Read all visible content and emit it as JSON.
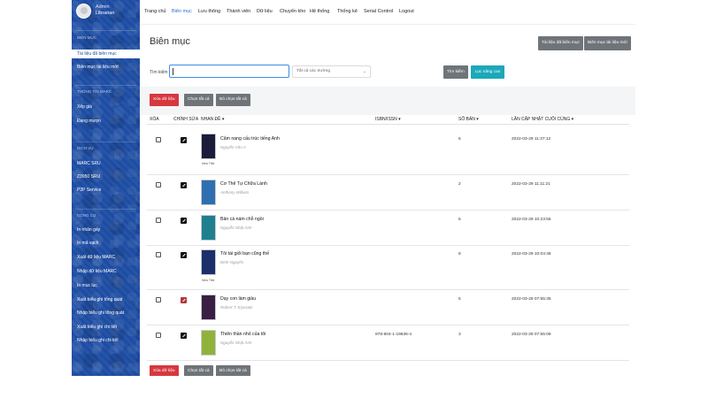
{
  "user": {
    "name": "Admin",
    "role": "Librarian"
  },
  "sidebar": {
    "sections": [
      {
        "title": "Biên mục",
        "items": [
          "Tài liệu đã biên mục",
          "Biên mục tài liệu mới"
        ]
      },
      {
        "title": "Thông tin MARC",
        "items": [
          "Xếp giá",
          "Đang mượn"
        ]
      },
      {
        "title": "Dịch vụ",
        "items": [
          "MARC SRU",
          "Z3950 SRU",
          "P2P Service"
        ]
      },
      {
        "title": "Công cụ",
        "items": [
          "In nhãn gáy",
          "In mã vạch",
          "Xuất dữ liệu MARC",
          "Nhập dữ liệu MARC",
          "In mục lục",
          "Xuất biểu ghi tổng quát",
          "Nhập biểu ghi tổng quát",
          "Xuất biểu ghi chi tiết",
          "Nhập biểu ghi chi tiết"
        ]
      }
    ],
    "active_item": "Tài liệu đã biên mục"
  },
  "topnav": {
    "items": [
      "Trang chủ",
      "Biên mục",
      "Lưu thông",
      "Thành viên",
      "Dữ liệu",
      "Chuyển kho",
      "Hệ thống",
      "Thống kê",
      "Serial Control",
      "Logout"
    ],
    "active": "Biên mục"
  },
  "page": {
    "title": "Biên mục",
    "header_buttons": [
      "Tài liệu đã biên mục",
      "Biên mục tài liệu mới"
    ]
  },
  "search": {
    "label": "Tìm kiếm",
    "value": "",
    "field_select": "Tất cả các trường",
    "search_button": "Tìm kiếm",
    "advanced_button": "Lọc nâng cao"
  },
  "bulk_actions": {
    "delete": "Xóa dữ liệu",
    "select_all": "Chọn tất cả",
    "deselect_all": "Bỏ chọn tất cả"
  },
  "table": {
    "headers": {
      "delete": "XÓA",
      "edit": "CHỈNH SỬA",
      "title": "NHAN ĐỀ ▾",
      "isbn": "ISBN/ISSN ▾",
      "copies": "SỐ BẢN ▾",
      "updated": "LẦN CẬP NHẬT CUỐI CÙNG ▾"
    },
    "rows": [
      {
        "title": "Cẩm nang cấu trúc tiếng Anh",
        "author": "Nguyễn Văn A",
        "isbn": "",
        "copies": "5",
        "updated": "2022-03-29 11:37:12",
        "cover_caption": "New Title",
        "cover_color": "#1a1c3a"
      },
      {
        "title": "Cơ Thể Tự Chữa Lành",
        "author": "Anthony William",
        "isbn": "",
        "copies": "2",
        "updated": "2022-03-29 11:11:21",
        "cover_caption": "",
        "cover_color": "#2e6fb0"
      },
      {
        "title": "Bản cà nám chỗ ngồi",
        "author": "Nguyễn Nhật Ánh",
        "isbn": "",
        "copies": "5",
        "updated": "2022-03-29 10:23:55",
        "cover_caption": "",
        "cover_color": "#1f7f8f"
      },
      {
        "title": "Tôi tài giỏi bạn cũng thế",
        "author": "Đình Nguyên",
        "isbn": "",
        "copies": "8",
        "updated": "2022-03-29 10:04:46",
        "cover_caption": "New Title",
        "cover_color": "#1c2f6b"
      },
      {
        "title": "Dạy con làm giàu",
        "author": "Robert T. Kiyosaki",
        "isbn": "",
        "copies": "5",
        "updated": "2022-03-29 07:55:35",
        "cover_caption": "",
        "cover_color": "#3a1e44"
      },
      {
        "title": "Thiên thần nhỏ của tôi",
        "author": "Nguyễn Nhật Ánh",
        "isbn": "978-604-1-19836-4",
        "copies": "3",
        "updated": "2022-03-29 07:55:09",
        "cover_caption": "",
        "cover_color": "#8fb33a"
      }
    ]
  }
}
